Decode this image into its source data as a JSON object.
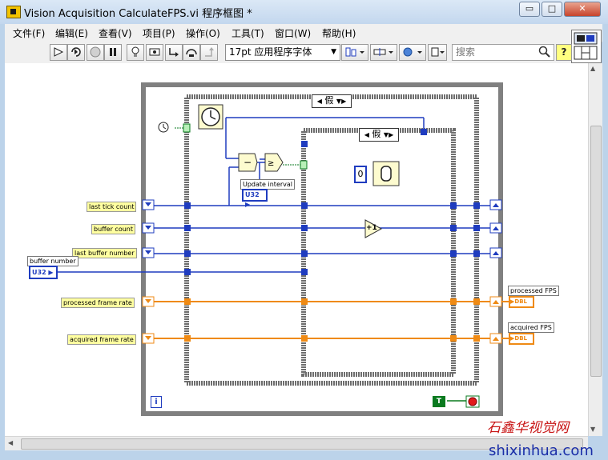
{
  "window": {
    "title": "Vision Acquisition CalculateFPS.vi 程序框图 *",
    "minimize_glyph": "▭",
    "maximize_glyph": "□",
    "close_glyph": "✕"
  },
  "menu": [
    {
      "label": "文件(F)"
    },
    {
      "label": "编辑(E)"
    },
    {
      "label": "查看(V)"
    },
    {
      "label": "项目(P)"
    },
    {
      "label": "操作(O)"
    },
    {
      "label": "工具(T)"
    },
    {
      "label": "窗口(W)"
    },
    {
      "label": "帮助(H)"
    }
  ],
  "toolbar": {
    "font_selector": "17pt 应用程序字体",
    "search_placeholder": "搜索",
    "help_glyph": "?"
  },
  "diagram": {
    "outer_case_selector": "假",
    "inner_case_selector": "假",
    "numeric_constant": "0",
    "increment_glyph": "+1",
    "iteration_glyph": "i",
    "true_constant": "T",
    "wire_colors": {
      "integer": "#1f3cbf",
      "float": "#ef8a14",
      "boolean": "#0a7a1f"
    },
    "terminals_left": [
      {
        "label": "last tick count"
      },
      {
        "label": "buffer count"
      },
      {
        "label": "last buffer number"
      },
      {
        "label": "processed frame rate"
      },
      {
        "label": "acquired frame rate"
      }
    ],
    "buffer_number": {
      "label": "buffer number",
      "type": "U32"
    },
    "update_interval": {
      "label": "Update interval",
      "type": "U32"
    },
    "indicators_right": [
      {
        "label": "processed FPS",
        "type": "DBL"
      },
      {
        "label": "acquired FPS",
        "type": "DBL"
      }
    ]
  },
  "watermark": {
    "logo_text": "石鑫华视觉网",
    "url": "shixinhua.com"
  }
}
